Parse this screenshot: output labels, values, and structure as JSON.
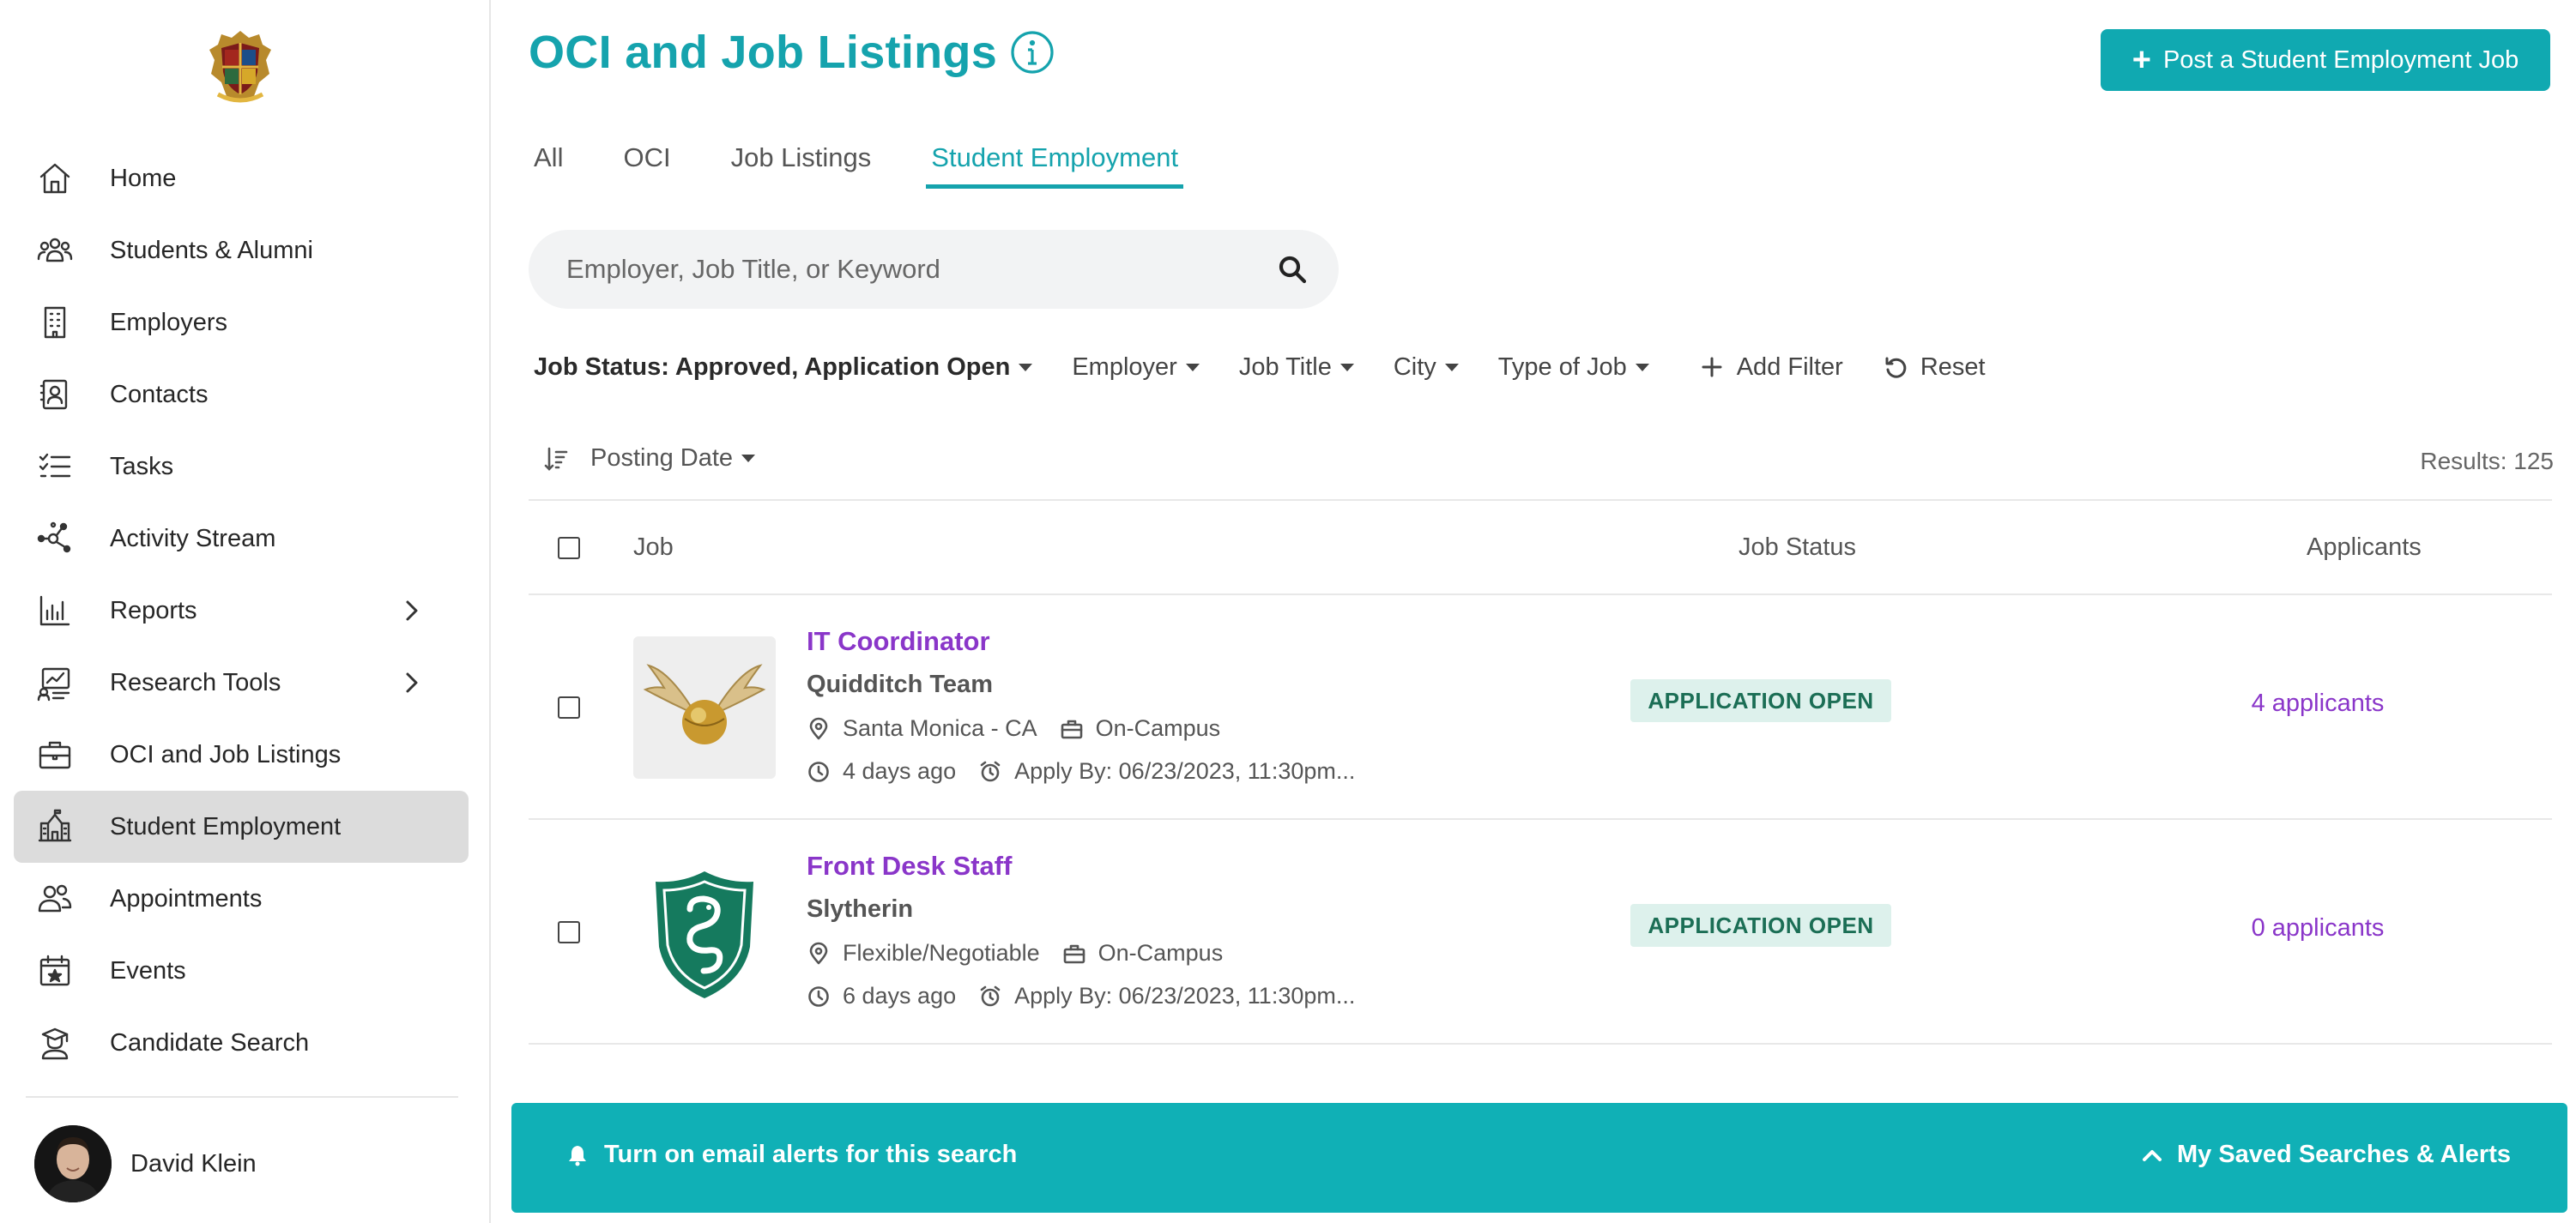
{
  "sidebar": {
    "logo_name": "hogwarts-crest",
    "items": [
      {
        "label": "Home",
        "icon": "home-icon"
      },
      {
        "label": "Students & Alumni",
        "icon": "people-icon"
      },
      {
        "label": "Employers",
        "icon": "building-icon"
      },
      {
        "label": "Contacts",
        "icon": "contact-card-icon"
      },
      {
        "label": "Tasks",
        "icon": "checklist-icon"
      },
      {
        "label": "Activity Stream",
        "icon": "network-icon"
      },
      {
        "label": "Reports",
        "icon": "bar-chart-icon",
        "has_submenu": true
      },
      {
        "label": "Research Tools",
        "icon": "research-chart-icon",
        "has_submenu": true
      },
      {
        "label": "OCI and Job Listings",
        "icon": "briefcase-icon"
      },
      {
        "label": "Student Employment",
        "icon": "school-icon",
        "active": true
      },
      {
        "label": "Appointments",
        "icon": "appointments-icon"
      },
      {
        "label": "Events",
        "icon": "calendar-star-icon"
      },
      {
        "label": "Candidate Search",
        "icon": "graduate-icon"
      }
    ],
    "user": {
      "name": "David Klein"
    }
  },
  "header": {
    "title": "OCI and Job Listings",
    "post_button": "Post a Student Employment Job"
  },
  "tabs": [
    {
      "label": "All",
      "active": false
    },
    {
      "label": "OCI",
      "active": false
    },
    {
      "label": "Job Listings",
      "active": false
    },
    {
      "label": "Student Employment",
      "active": true
    }
  ],
  "search": {
    "placeholder": "Employer, Job Title, or Keyword",
    "value": ""
  },
  "filters": {
    "job_status": "Job Status: Approved, Application Open",
    "employer": "Employer",
    "job_title": "Job Title",
    "city": "City",
    "type_of_job": "Type of Job",
    "add_filter": "Add Filter",
    "reset": "Reset"
  },
  "sort": {
    "label": "Posting Date"
  },
  "results": "Results: 125",
  "table": {
    "headers": {
      "job": "Job",
      "status": "Job Status",
      "applicants": "Applicants"
    },
    "rows": [
      {
        "title": "IT Coordinator",
        "company": "Quidditch Team",
        "location": "Santa Monica - CA",
        "work_type": "On-Campus",
        "posted": "4 days ago",
        "apply_by": "Apply By: 06/23/2023, 11:30pm...",
        "status": "APPLICATION OPEN",
        "applicants": "4 applicants",
        "logo": "golden-snitch-logo"
      },
      {
        "title": "Front Desk Staff",
        "company": "Slytherin",
        "location": "Flexible/Negotiable",
        "work_type": "On-Campus",
        "posted": "6 days ago",
        "apply_by": "Apply By: 06/23/2023, 11:30pm...",
        "status": "APPLICATION OPEN",
        "applicants": "0 applicants",
        "logo": "slytherin-shield-logo"
      }
    ]
  },
  "alert_bar": {
    "left": "Turn on email alerts for this search",
    "right": "My Saved Searches & Alerts"
  },
  "colors": {
    "accent": "#15a3ad",
    "link_purple": "#8a36c9",
    "status_bg": "#ddf1ec",
    "status_text": "#1b6e55",
    "active_nav_bg": "#dcdcdc"
  }
}
